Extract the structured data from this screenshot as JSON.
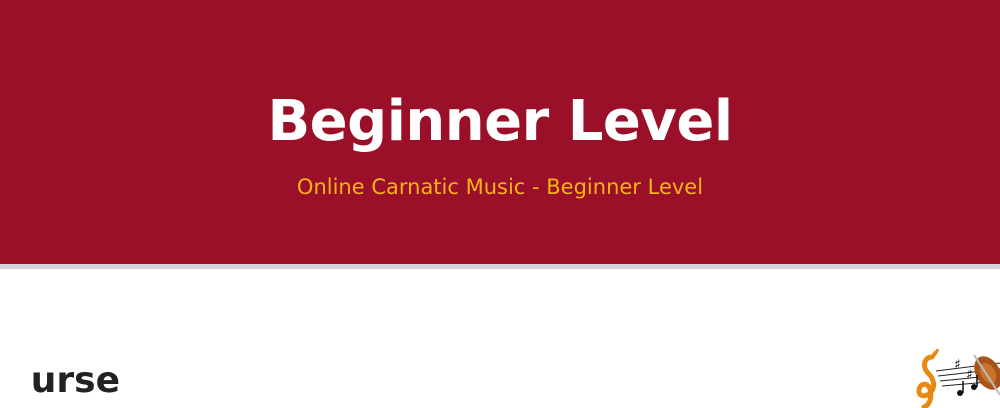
{
  "hero": {
    "title": "Beginner Level",
    "subtitle": "Online Carnatic Music - Beginner Level",
    "background_color": "#9a1028",
    "subtitle_color": "#f6b21a"
  },
  "content": {
    "section_heading": "urse"
  },
  "graphic": {
    "icon": "music-notes-violin-illustration"
  }
}
